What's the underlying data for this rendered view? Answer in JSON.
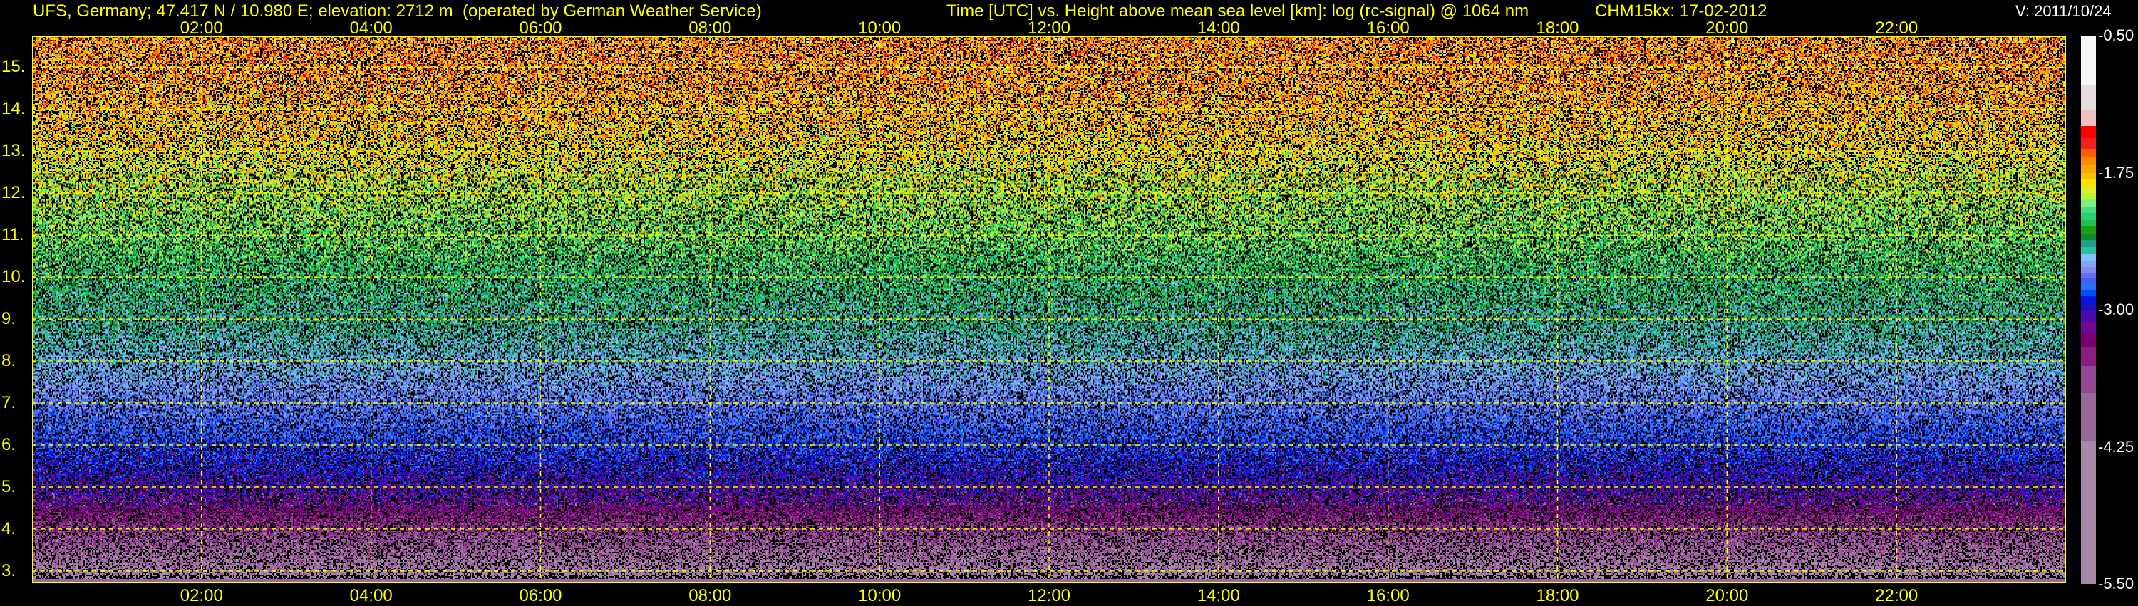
{
  "header": {
    "station": "UFS, Germany; 47.417 N / 10.980 E; elevation: 2712 m  (operated by German Weather Service)",
    "title": "Time [UTC] vs. Height above mean sea level [km]: log (rc-signal) @ 1064 nm",
    "instrument_date": "CHM15kx: 17-02-2012",
    "version": "V: 2011/10/24"
  },
  "chart_data": {
    "type": "heatmap",
    "title": "Time [UTC] vs. Height above mean sea level [km]: log (rc-signal) @ 1064 nm",
    "xlabel": "Time [UTC]",
    "ylabel": "Height above mean sea level [km]",
    "xlim": [
      0,
      24
    ],
    "ylim": [
      2.71,
      15.75
    ],
    "x_ticks": [
      "02:00",
      "04:00",
      "06:00",
      "08:00",
      "10:00",
      "12:00",
      "14:00",
      "16:00",
      "18:00",
      "20:00",
      "22:00"
    ],
    "x_tick_hours": [
      2,
      4,
      6,
      8,
      10,
      12,
      14,
      16,
      18,
      20,
      22
    ],
    "y_ticks": [
      "3.",
      "4.",
      "5.",
      "6.",
      "7.",
      "8.",
      "9.",
      "10.",
      "11.",
      "12.",
      "13.",
      "14.",
      "15."
    ],
    "y_tick_values": [
      3,
      4,
      5,
      6,
      7,
      8,
      9,
      10,
      11,
      12,
      13,
      14,
      15
    ],
    "grid": true,
    "grid_color": "#ffff00",
    "description_of_field": "noisy signal; log(rc-signal) decreasing with height: ~-5.5 near 3 km, ~-3 around 6-8 km, ~-1.5 above 13 km",
    "colorbar": {
      "range": [
        -5.5,
        -0.5
      ],
      "labels": [
        "-0.50",
        "-1.75",
        "-3.00",
        "-4.25",
        "-5.50"
      ],
      "colors_top_to_bottom": [
        "#f7f7f7",
        "#e6dede",
        "#f0c0c0",
        "#ff0000",
        "#f02020",
        "#ff5a00",
        "#ff8c00",
        "#f8a800",
        "#f8c000",
        "#f8e000",
        "#d8f030",
        "#c0f030",
        "#80f080",
        "#40e080",
        "#28d070",
        "#20c050",
        "#18a018",
        "#108830",
        "#20a088",
        "#28c0a0",
        "#80c0f8",
        "#80a8f0",
        "#8888f0",
        "#6070f0",
        "#4060f0",
        "#2870f8",
        "#0050f8",
        "#0018e0",
        "#2010c0",
        "#5008b0",
        "#700898",
        "#780070",
        "#882080",
        "#904890",
        "#986898",
        "#a888a8"
      ]
    }
  }
}
